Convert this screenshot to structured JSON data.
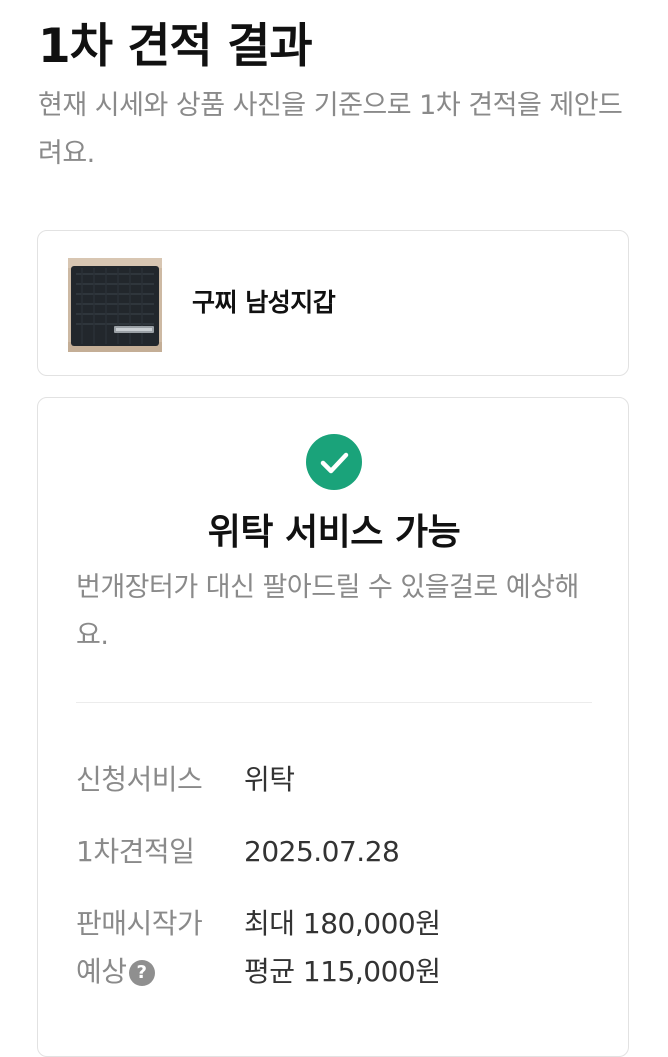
{
  "page": {
    "title": "1차 견적 결과",
    "description": "현재 시세와 상품 사진을 기준으로 1차 견적을 제안드려요."
  },
  "product": {
    "name": "구찌 남성지갑",
    "thumbnail_icon": "wallet-photo"
  },
  "result": {
    "status_icon": "check-circle-icon",
    "status_color": "#1aa37a",
    "title": "위탁 서비스 가능",
    "description": "번개장터가 대신 팔아드릴 수 있을걸로 예상해요.",
    "rows": {
      "service": {
        "label": "신청서비스",
        "value": "위탁"
      },
      "estimate_date": {
        "label": "1차견적일",
        "value": "2025.07.28"
      },
      "expected_price": {
        "label_line1": "판매시작가",
        "label_line2": "예상",
        "help_glyph": "?",
        "max": "최대 180,000원",
        "avg": "평균 115,000원"
      }
    }
  }
}
